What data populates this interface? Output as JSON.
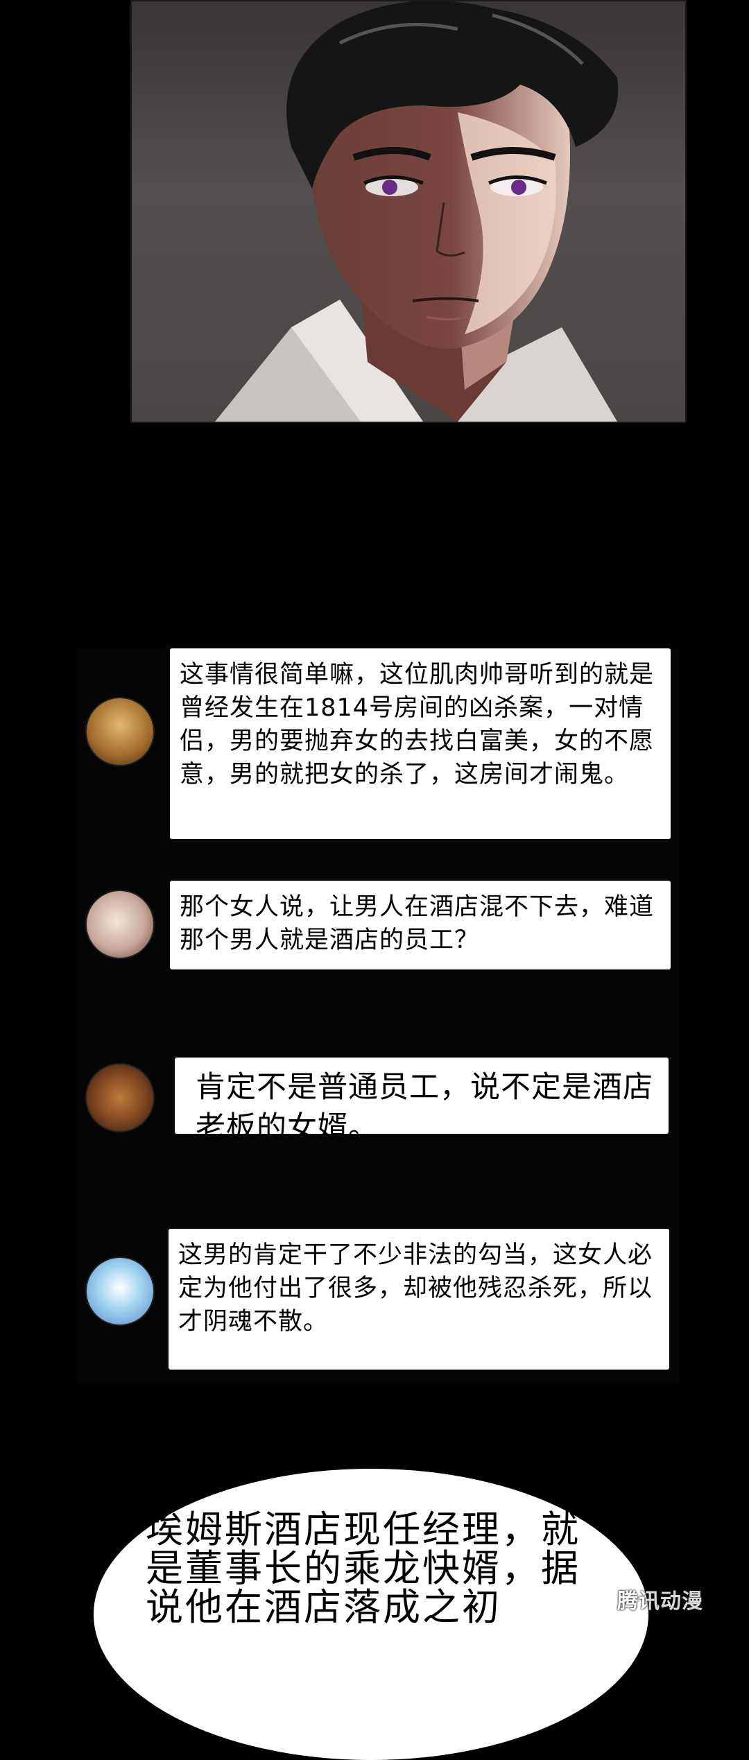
{
  "messages": [
    {
      "avatar_icon": "blonde-character-avatar",
      "text": "这事情很简单嘛，这位肌肉帅哥听到的就是曾经发生在1814号房间的凶杀案，一对情侣，男的要抛弃女的去找白富美，女的不愿意，男的就把女的杀了，这房间才闹鬼。"
    },
    {
      "avatar_icon": "pale-character-avatar",
      "text": "那个女人说，让男人在酒店混不下去，难道那个男人就是酒店的员工？"
    },
    {
      "avatar_icon": "lion-avatar",
      "text": "肯定不是普通员工，说不定是酒店老板的女婿。"
    },
    {
      "avatar_icon": "anime-girl-avatar",
      "text": "这男的肯定干了不少非法的勾当，这女人必定为他付出了很多，却被他残忍杀死，所以才阴魂不散。"
    }
  ],
  "narration": {
    "lines": [
      "埃姆斯酒店现任经理，就",
      "是董事长的乘龙快婿，据",
      "说他在酒店落成之初"
    ]
  },
  "watermark": "腾讯动漫"
}
